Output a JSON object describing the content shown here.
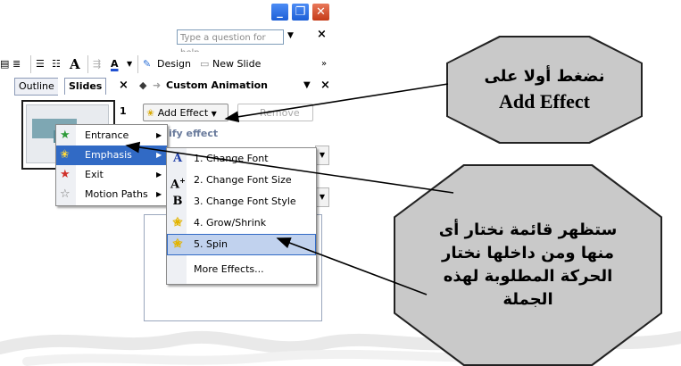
{
  "window": {
    "minimize_glyph": "_",
    "maximize_glyph": "❐",
    "close_glyph": "✕"
  },
  "helpbar": {
    "placeholder": "Type a question for help",
    "dropdown_glyph": "▼",
    "close_glyph": "×"
  },
  "toolbar": {
    "design_label": "Design",
    "new_slide_label": "New Slide"
  },
  "leftpane": {
    "tab_outline": "Outline",
    "tab_slides": "Slides",
    "close_glyph": "×",
    "slide_number": "1"
  },
  "taskpane": {
    "title": "Custom Animation",
    "add_effect_label": "Add Effect",
    "remove_label": "Remove",
    "modify_label": "ify effect",
    "close_glyph": "×"
  },
  "menu_effect_types": {
    "items": [
      {
        "label": "Entrance",
        "icon": "green-star-icon"
      },
      {
        "label": "Emphasis",
        "icon": "yellow-star-icon"
      },
      {
        "label": "Exit",
        "icon": "red-star-icon"
      },
      {
        "label": "Motion Paths",
        "icon": "outline-star-icon"
      }
    ],
    "highlighted": "Emphasis"
  },
  "menu_emphasis": {
    "items": [
      {
        "label": "1. Change Font",
        "icon": "change-font-icon"
      },
      {
        "label": "2. Change Font Size",
        "icon": "change-font-size-icon"
      },
      {
        "label": "3. Change Font Style",
        "icon": "bold-b-icon"
      },
      {
        "label": "4. Grow/Shrink",
        "icon": "grow-shrink-icon"
      },
      {
        "label": "5. Spin",
        "icon": "spin-icon"
      }
    ],
    "highlighted": "5. Spin",
    "more_label": "More Effects..."
  },
  "callouts": {
    "first_line1": "نضغط أولا على",
    "first_line2": "Add Effect",
    "second_line1": "ستظهر قائمة نختار أى",
    "second_line2": "منها ومن داخلها نختار",
    "second_line3": "الحركة المطلوبة لهذه",
    "second_line4": "الجملة"
  },
  "colors": {
    "menu_highlight": "#316ac5",
    "submenu_highlight": "#c1d2ee",
    "callout_fill": "#c9c9c9"
  }
}
